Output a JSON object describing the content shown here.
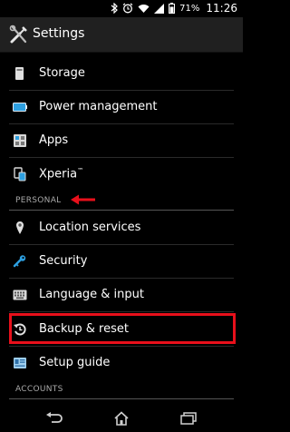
{
  "status_bar": {
    "battery_percent": "71%",
    "time": "11:26",
    "icons": [
      "bluetooth-icon",
      "alarm-icon",
      "wifi-icon",
      "signal-icon",
      "battery-icon"
    ]
  },
  "action_bar": {
    "title": "Settings",
    "icon": "tools-icon"
  },
  "items_device": [
    {
      "label": "Storage",
      "icon": "storage-icon"
    },
    {
      "label": "Power management",
      "icon": "battery-icon"
    },
    {
      "label": "Apps",
      "icon": "apps-icon"
    },
    {
      "label": "Xperia",
      "sup": "™",
      "icon": "xperia-icon"
    }
  ],
  "section_personal": "PERSONAL",
  "items_personal": [
    {
      "label": "Location services",
      "icon": "location-pin-icon"
    },
    {
      "label": "Security",
      "icon": "security-icon"
    },
    {
      "label": "Language & input",
      "icon": "keyboard-icon"
    },
    {
      "label": "Backup & reset",
      "icon": "backup-reset-icon"
    },
    {
      "label": "Setup guide",
      "icon": "setup-guide-icon"
    }
  ],
  "section_accounts": "ACCOUNTS",
  "nav": [
    "back-icon",
    "home-icon",
    "recent-apps-icon"
  ],
  "colors": {
    "annotation_red": "#e8101b",
    "section_text": "#a9a9a9",
    "accent_blue": "#2d9fe0"
  }
}
